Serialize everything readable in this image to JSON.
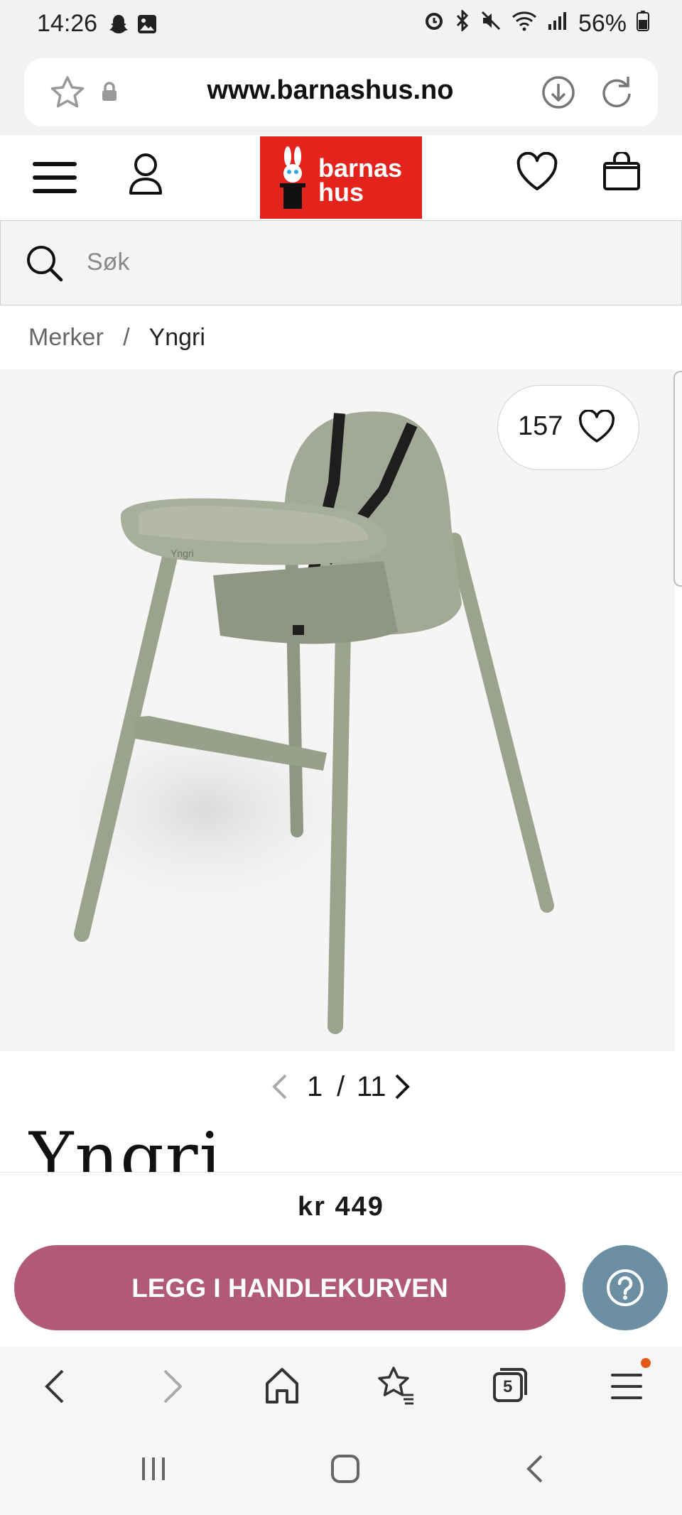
{
  "status": {
    "time": "14:26",
    "battery": "56%"
  },
  "browser": {
    "url": "www.barnashus.no"
  },
  "header": {
    "logo_line1": "barnas",
    "logo_line2": "hus"
  },
  "search": {
    "placeholder": "Søk"
  },
  "breadcrumb": {
    "items": [
      "Merker",
      "Yngri"
    ],
    "separator": "/"
  },
  "gallery": {
    "likes": "157",
    "current": "1",
    "separator": "/",
    "total": "11"
  },
  "brand": {
    "name": "Yngri"
  },
  "product": {
    "price": "kr 449",
    "add_to_cart": "LEGG I HANDLEKURVEN"
  },
  "tabs": {
    "count": "5"
  },
  "colors": {
    "logo_red": "#e4231c",
    "cart_button": "#b05a78",
    "help_button": "#6c8ea3",
    "chair_green": "#9ca38d"
  }
}
